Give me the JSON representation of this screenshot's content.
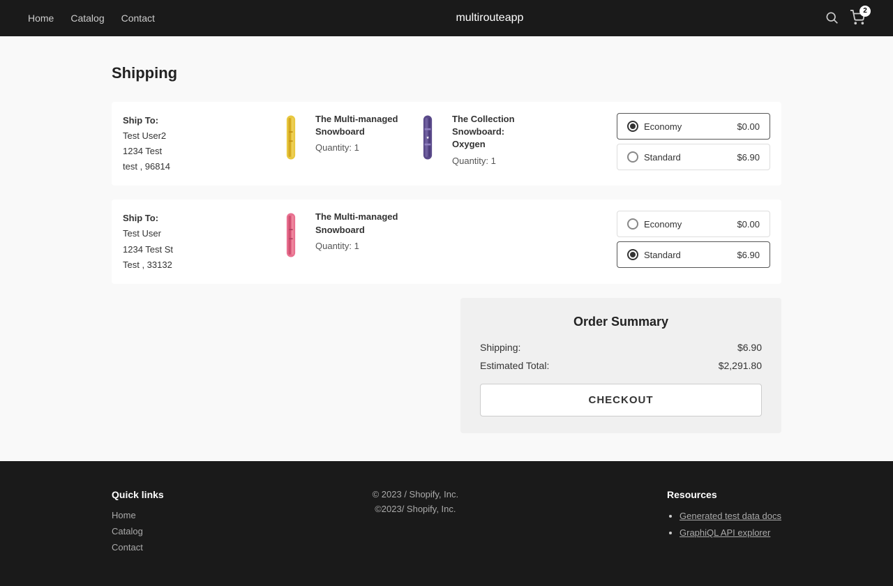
{
  "header": {
    "logo": "multirouteapp",
    "nav": [
      "Home",
      "Catalog",
      "Contact"
    ],
    "cart_count": "2"
  },
  "page": {
    "title": "Shipping"
  },
  "shipping_rows": [
    {
      "ship_to_label": "Ship To:",
      "name": "Test User2",
      "address1": "1234 Test",
      "address2": "test , 96814",
      "products": [
        {
          "name": "The Multi-managed Snowboard",
          "qty_label": "Quantity: 1",
          "color": "yellow"
        }
      ],
      "options": [
        {
          "label": "Economy",
          "price": "$0.00",
          "selected": true
        },
        {
          "label": "Standard",
          "price": "$6.90",
          "selected": false
        }
      ]
    },
    {
      "ship_to_label": "Ship To:",
      "name": "Test User",
      "address1": "1234 Test St",
      "address2": "Test , 33132",
      "products": [
        {
          "name": "The Multi-managed Snowboard",
          "qty_label": "Quantity: 1",
          "color": "pink"
        }
      ],
      "options": [
        {
          "label": "Economy",
          "price": "$0.00",
          "selected": false
        },
        {
          "label": "Standard",
          "price": "$6.90",
          "selected": true
        }
      ]
    }
  ],
  "row1_product2": {
    "name": "The Collection Snowboard: Oxygen",
    "qty_label": "Quantity: 1"
  },
  "order_summary": {
    "title": "Order Summary",
    "shipping_label": "Shipping:",
    "shipping_value": "$6.90",
    "total_label": "Estimated Total:",
    "total_value": "$2,291.80",
    "checkout_label": "CHECKOUT"
  },
  "footer": {
    "quick_links_title": "Quick links",
    "quick_links": [
      "Home",
      "Catalog",
      "Contact"
    ],
    "center_text1": "© 2023 / Shopify, Inc.",
    "center_text2": "©2023/ Shopify, Inc.",
    "resources_title": "Resources",
    "resources": [
      {
        "label": "Generated test data docs",
        "href": "#"
      },
      {
        "label": "GraphiQL API explorer",
        "href": "#"
      }
    ]
  }
}
